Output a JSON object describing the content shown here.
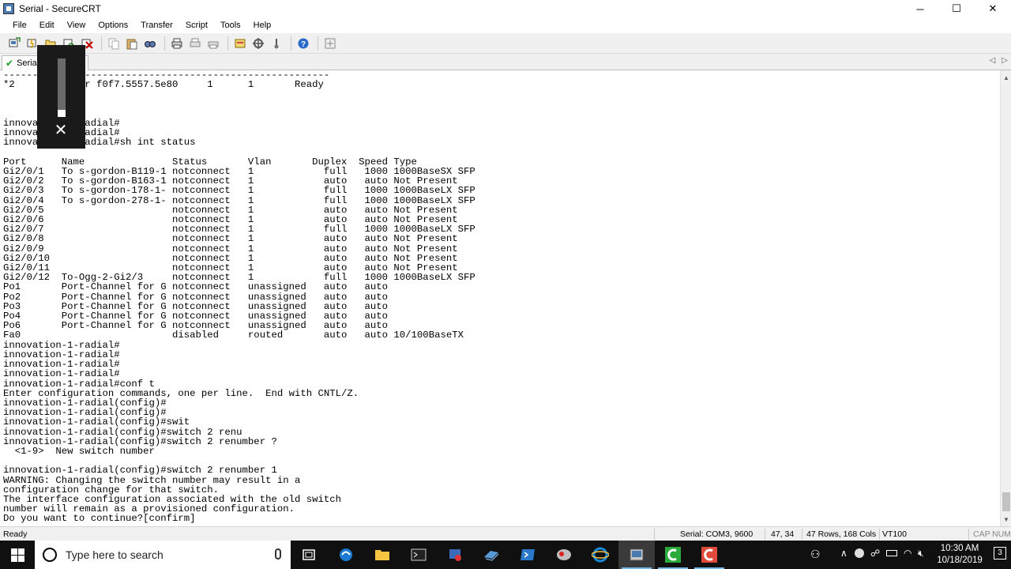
{
  "window": {
    "title": "Serial - SecureCRT",
    "controls": {
      "minimize": "─",
      "maximize": "☐",
      "close": "✕"
    }
  },
  "menu": [
    "File",
    "Edit",
    "View",
    "Options",
    "Transfer",
    "Script",
    "Tools",
    "Help"
  ],
  "toolbar_icons": [
    "connect-icon",
    "quick-connect-icon",
    "connect-in-tab-icon",
    "reconnect-icon",
    "disconnect-icon",
    "copy-icon",
    "paste-icon",
    "find-icon",
    "print-icon",
    "print-selection-icon",
    "print-setup-icon",
    "session-options-icon",
    "global-options-icon",
    "sftp-icon",
    "help-icon",
    "keymap-icon"
  ],
  "tab": {
    "label": "Serial",
    "status_icon": "connected-check-icon",
    "nav_left": "◁",
    "nav_right": "▷"
  },
  "terminal_lines": [
    "--------------------------------------------------------",
    "*2       Master f0f7.5557.5e80     1      1       Ready",
    "",
    "",
    "",
    "innovation-1-radial#",
    "innovation-1-radial#",
    "innovation-1-radial#sh int status",
    "",
    "Port      Name               Status       Vlan       Duplex  Speed Type",
    "Gi2/0/1   To s-gordon-B119-1 notconnect   1            full   1000 1000BaseSX SFP",
    "Gi2/0/2   To s-gordon-B163-1 notconnect   1            auto   auto Not Present",
    "Gi2/0/3   To s-gordon-178-1- notconnect   1            full   1000 1000BaseLX SFP",
    "Gi2/0/4   To s-gordon-278-1- notconnect   1            full   1000 1000BaseLX SFP",
    "Gi2/0/5                      notconnect   1            auto   auto Not Present",
    "Gi2/0/6                      notconnect   1            auto   auto Not Present",
    "Gi2/0/7                      notconnect   1            full   1000 1000BaseLX SFP",
    "Gi2/0/8                      notconnect   1            auto   auto Not Present",
    "Gi2/0/9                      notconnect   1            auto   auto Not Present",
    "Gi2/0/10                     notconnect   1            auto   auto Not Present",
    "Gi2/0/11                     notconnect   1            auto   auto Not Present",
    "Gi2/0/12  To-Ogg-2-Gi2/3     notconnect   1            full   1000 1000BaseLX SFP",
    "Po1       Port-Channel for G notconnect   unassigned   auto   auto",
    "Po2       Port-Channel for G notconnect   unassigned   auto   auto",
    "Po3       Port-Channel for G notconnect   unassigned   auto   auto",
    "Po4       Port-Channel for G notconnect   unassigned   auto   auto",
    "Po6       Port-Channel for G notconnect   unassigned   auto   auto",
    "Fa0                          disabled     routed       auto   auto 10/100BaseTX",
    "innovation-1-radial#",
    "innovation-1-radial#",
    "innovation-1-radial#",
    "innovation-1-radial#",
    "innovation-1-radial#conf t",
    "Enter configuration commands, one per line.  End with CNTL/Z.",
    "innovation-1-radial(config)#",
    "innovation-1-radial(config)#",
    "innovation-1-radial(config)#swit",
    "innovation-1-radial(config)#switch 2 renu",
    "innovation-1-radial(config)#switch 2 renumber ?",
    "  <1-9>  New switch number",
    "",
    "innovation-1-radial(config)#switch 2 renumber 1",
    "WARNING: Changing the switch number may result in a",
    "configuration change for that switch.",
    "The interface configuration associated with the old switch",
    "number will remain as a provisioned configuration.",
    "Do you want to continue?[confirm]"
  ],
  "overlay": {
    "level": 0.12,
    "close": "✕"
  },
  "statusbar": {
    "ready": "Ready",
    "connection": "Serial: COM3, 9600",
    "cursor": "47, 34",
    "size": "47 Rows, 168 Cols",
    "emulation": "VT100",
    "cap": "CAP",
    "num": "NUM"
  },
  "taskbar": {
    "search_placeholder": "Type here to search",
    "apps": [
      "task-view-icon",
      "edge-icon",
      "file-explorer-icon",
      "terminal-icon",
      "vpn-icon",
      "network-tool-icon",
      "powershell-icon",
      "snipping-icon",
      "ie-icon",
      "securecrt-icon",
      "green-app-icon",
      "red-app-icon"
    ],
    "time": "10:30 AM",
    "date": "10/18/2019",
    "notification_count": "3"
  }
}
